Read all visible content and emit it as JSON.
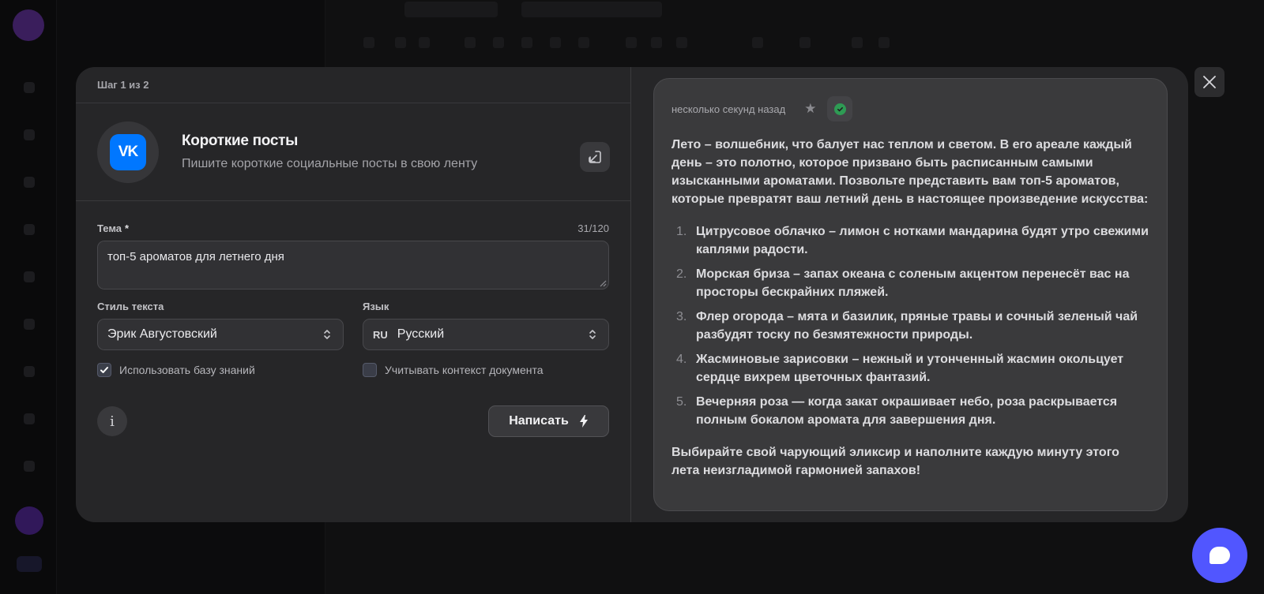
{
  "modal": {
    "step": "Шаг 1 из 2",
    "header": {
      "logo_text": "VK",
      "title": "Короткие посты",
      "subtitle": "Пишите короткие социальные посты в свою ленту"
    },
    "form": {
      "topic_label": "Тема",
      "required_mark": "*",
      "counter": "31/120",
      "topic_value": "топ-5 ароматов для летнего дня",
      "style_label": "Стиль текста",
      "style_value": "Эрик Августовский",
      "language_label": "Язык",
      "language_code": "RU",
      "language_value": "Русский",
      "use_kb_label": "Использовать базу знаний",
      "use_kb_checked": true,
      "doc_context_label": "Учитывать контекст документа",
      "doc_context_checked": false,
      "info_glyph": "i",
      "write_button": "Написать"
    },
    "result": {
      "timestamp": "несколько секунд назад",
      "intro": "Лето – волшебник, что балует нас теплом и светом. В его ареале каждый день – это полотно, которое призвано быть расписанным самыми изысканными ароматами. Позвольте представить вам топ-5 ароматов, которые превратят ваш летний день в настоящее произведение искусства:",
      "items": [
        {
          "num": "1.",
          "text": "Цитрусовое облачко – лимон с нотками мандарина будят утро свежими каплями радости."
        },
        {
          "num": "2.",
          "text": "Морская бриза – запах океана с соленым акцентом перенесёт вас на просторы бескрайних пляжей."
        },
        {
          "num": "3.",
          "text": "Флер огорода – мята и базилик, пряные травы и сочный зеленый чай разбудят тоску по безмятежности природы."
        },
        {
          "num": "4.",
          "text": "Жасминовые зарисовки – нежный и утонченный жасмин окольцует сердце вихрем цветочных фантазий."
        },
        {
          "num": "5.",
          "text": "Вечерняя роза — когда закат окрашивает небо, роза раскрывается полным бокалом аромата для завершения дня."
        }
      ],
      "closing": "Выбирайте свой чарующий эликсир и наполните каждую минуту этого лета неизгладимой гармонией запахов!"
    }
  },
  "icons": {
    "vk_logo": "vk-logo-icon",
    "open_external": "open-external-icon",
    "chevron_updown": "chevron-updown-icon",
    "checkmark": "checkmark-icon",
    "info": "info-icon",
    "bolt": "bolt-icon",
    "star": "star-icon",
    "check_circle": "check-circle-icon",
    "close": "close-icon",
    "chat": "chat-bubble-icon"
  },
  "colors": {
    "vk_blue": "#0077ff",
    "chat_accent": "#5156ff",
    "success_green": "#2e9b54"
  }
}
